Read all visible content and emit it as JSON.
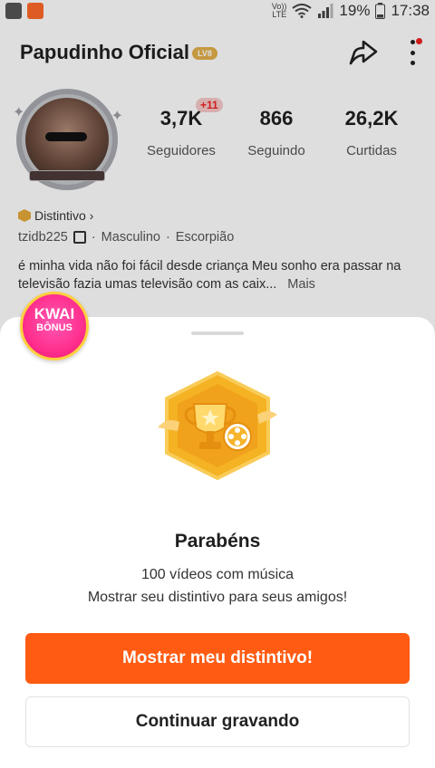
{
  "status_bar": {
    "network": "Vo))\nLTE",
    "battery": "19%",
    "time": "17:38"
  },
  "profile": {
    "name": "Papudinho Oficial",
    "level": "LV8",
    "stats": [
      {
        "value": "3,7K",
        "label": "Seguidores",
        "delta": "+11"
      },
      {
        "value": "866",
        "label": "Seguindo"
      },
      {
        "value": "26,2K",
        "label": "Curtidas"
      }
    ],
    "badge_label": "Distintivo ›",
    "username": "tzidb225",
    "gender": "Masculino",
    "sign": "Escorpião",
    "separator": "·",
    "bio": "é minha vida não foi fácil desde criança Meu sonho era passar na televisão fazia umas televisão com as caix...",
    "bio_more": "Mais"
  },
  "kwai_bonus": {
    "line1": "KWAI",
    "line2": "BÔNUS"
  },
  "sheet": {
    "title": "Parabéns",
    "subtitle1": "100 vídeos com música",
    "subtitle2": "Mostrar seu distintivo para seus amigos!",
    "primary_button": "Mostrar meu distintivo!",
    "secondary_button": "Continuar gravando"
  },
  "colors": {
    "accent": "#ff5b12",
    "badge_gold": "#f5b223",
    "kwai_pink": "#ff2f8e"
  }
}
